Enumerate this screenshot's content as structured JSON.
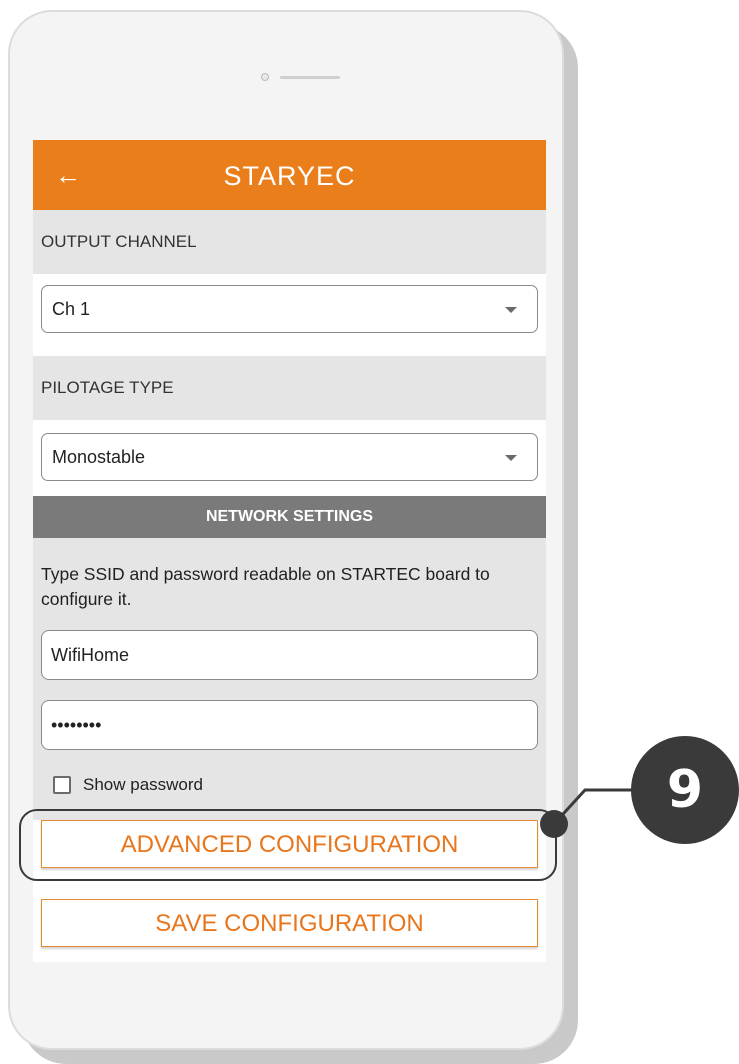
{
  "app": {
    "title": "STARYEC",
    "back_icon": "arrow-left-icon"
  },
  "output_channel": {
    "header": "OUTPUT CHANNEL",
    "selected": "Ch 1"
  },
  "pilotage_type": {
    "header": "PILOTAGE TYPE",
    "selected": "Monostable"
  },
  "network_settings": {
    "header": "NETWORK SETTINGS",
    "description": "Type SSID and password readable on STARTEC board to configure it.",
    "ssid_value": "WifiHome",
    "password_value": "••••••••",
    "show_password_label": "Show password",
    "show_password_checked": false
  },
  "buttons": {
    "advanced": "ADVANCED CONFIGURATION",
    "save": "SAVE CONFIGURATION"
  },
  "callout": {
    "number": "9"
  },
  "colors": {
    "accent": "#ea7e1a",
    "button_text": "#e8761c",
    "section_bg": "#e6e5e5",
    "network_header_bg": "#7a7a7a",
    "callout": "#3a3a3a"
  }
}
